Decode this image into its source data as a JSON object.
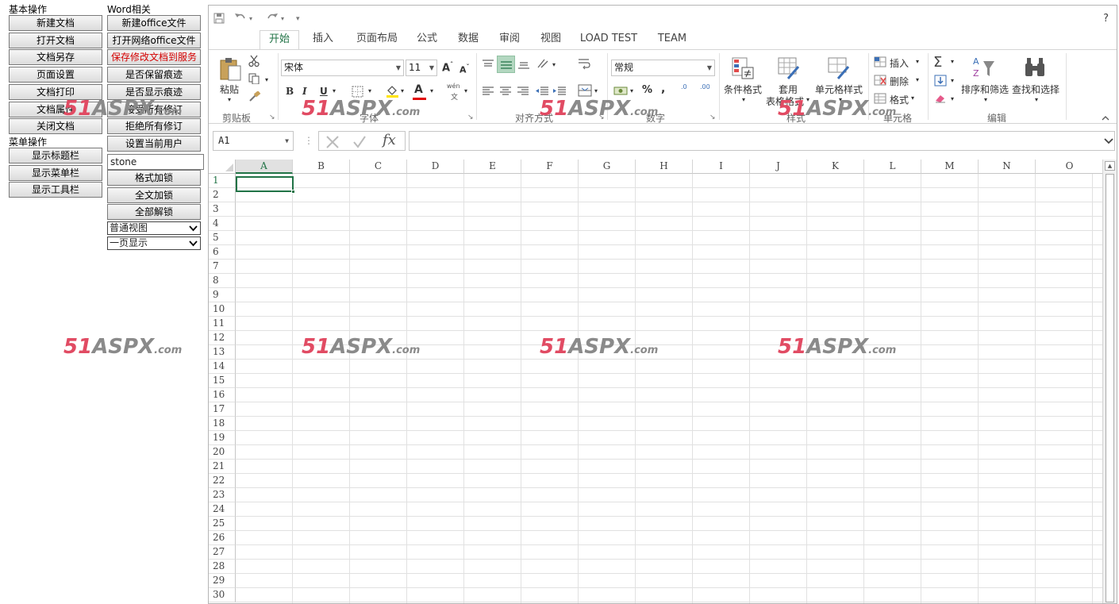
{
  "left_panel": {
    "basic_title": "基本操作",
    "basic_buttons": [
      "新建文档",
      "打开文档",
      "文档另存",
      "页面设置",
      "文档打印",
      "文档属性",
      "关闭文档"
    ],
    "menu_title": "菜单操作",
    "menu_buttons": [
      "显示标题栏",
      "显示菜单栏",
      "显示工具栏"
    ],
    "word_title": "Word相关",
    "word_buttons": [
      "新建office文件",
      "打开网络office文件",
      "保存修改文档到服务",
      "是否保留痕迹",
      "是否显示痕迹",
      "接受所有修订",
      "拒绝所有修订",
      "设置当前用户"
    ],
    "user_input_value": "stone",
    "lock_buttons": [
      "格式加锁",
      "全文加锁",
      "全部解锁"
    ],
    "view_select": "普通视图",
    "page_select": "一页显示",
    "colors": {
      "save_button_text": "#d40000"
    }
  },
  "excel": {
    "help": "?",
    "tabs": [
      {
        "label": "开始",
        "active": true
      },
      {
        "label": "插入"
      },
      {
        "label": "页面布局"
      },
      {
        "label": "公式"
      },
      {
        "label": "数据"
      },
      {
        "label": "审阅"
      },
      {
        "label": "视图"
      },
      {
        "label": "LOAD TEST"
      },
      {
        "label": "TEAM"
      }
    ],
    "ribbon": {
      "clipboard": {
        "paste": "粘贴",
        "label": "剪贴板"
      },
      "font": {
        "name": "宋体",
        "size": "11",
        "bold": "B",
        "italic": "I",
        "underline": "U",
        "label": "字体",
        "phonetic": "wén",
        "font_color_glyph": "A"
      },
      "alignment": {
        "label": "对齐方式"
      },
      "number": {
        "format": "常规",
        "percent": "%",
        "comma": ",",
        "inc_decimal": ".0",
        "dec_decimal": ".00",
        "label": "数字"
      },
      "styles": {
        "conditional": "条件格式",
        "table_format_1": "套用",
        "table_format_2": "表格格式",
        "cell_styles": "单元格样式",
        "label": "样式"
      },
      "cells": {
        "insert": "插入",
        "delete": "删除",
        "format": "格式",
        "label": "单元格"
      },
      "editing": {
        "sort_filter": "排序和筛选",
        "find_select": "查找和选择",
        "label": "编辑",
        "sigma": "Σ"
      }
    },
    "name_box": "A1",
    "fx": "fx",
    "columns": [
      "A",
      "B",
      "C",
      "D",
      "E",
      "F",
      "G",
      "H",
      "I",
      "J",
      "K",
      "L",
      "M",
      "N",
      "O"
    ],
    "rows": [
      "1",
      "2",
      "3",
      "4",
      "5",
      "6",
      "7",
      "8",
      "9",
      "10",
      "11",
      "12",
      "13",
      "14",
      "15",
      "16",
      "17",
      "18",
      "19",
      "20",
      "21",
      "22",
      "23",
      "24",
      "25",
      "26",
      "27",
      "28",
      "29",
      "30"
    ],
    "selected_cell": "A1",
    "colors": {
      "accent": "#217346"
    }
  },
  "watermark": {
    "num": "51",
    "brand": "ASPX",
    "suffix": ".com"
  }
}
